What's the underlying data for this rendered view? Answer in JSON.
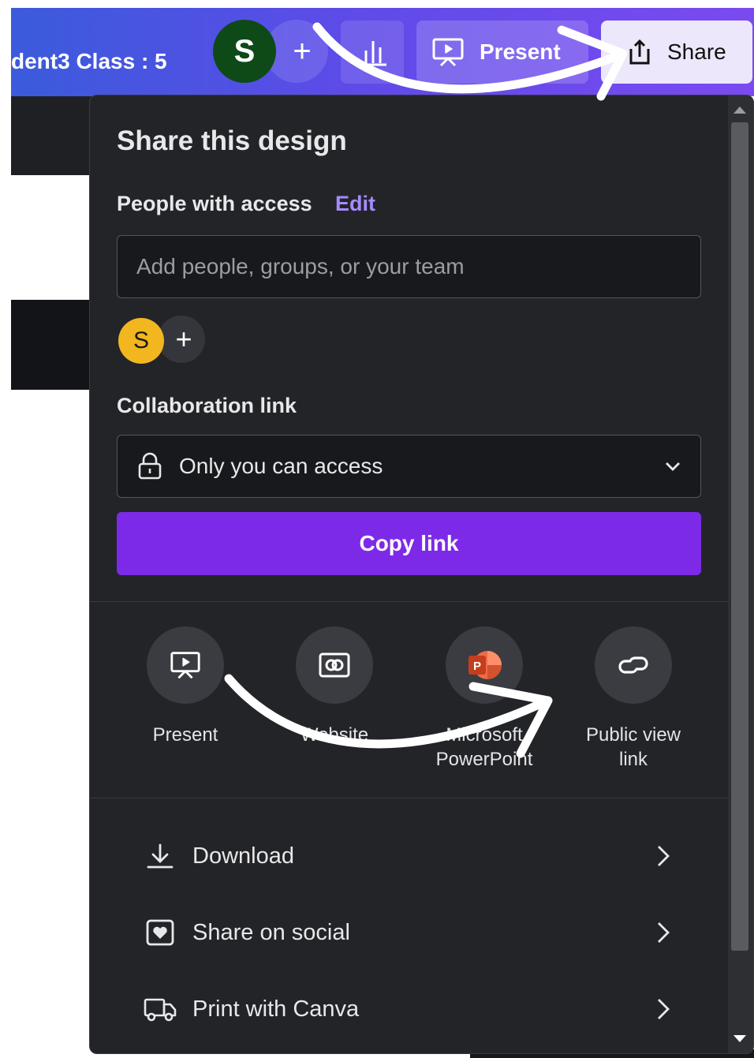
{
  "header": {
    "doc_title": "dent3 Class : 5",
    "avatar_initial": "S",
    "add_icon": "plus-icon",
    "insights_icon": "bar-chart-icon",
    "present_label": "Present",
    "share_label": "Share",
    "gradient_start": "#3b5bdb",
    "gradient_end": "#7a4af0",
    "avatar_color": "#0e4a17"
  },
  "share_panel": {
    "title": "Share this design",
    "people_access_label": "People with access",
    "edit_label": "Edit",
    "add_people_placeholder": "Add people, groups, or your team",
    "member_initial": "S",
    "member_color": "#f2b61f",
    "collaboration_label": "Collaboration link",
    "access_value": "Only you can access",
    "copy_link_label": "Copy link",
    "accent": "#7d2ae8",
    "share_options": [
      {
        "icon": "presentation-icon",
        "label": "Present"
      },
      {
        "icon": "website-icon",
        "label": "Website"
      },
      {
        "icon": "powerpoint-icon",
        "label": "Microsoft PowerPoint"
      },
      {
        "icon": "link-icon",
        "label": "Public view link"
      }
    ],
    "menu": [
      {
        "icon": "download-icon",
        "label": "Download"
      },
      {
        "icon": "heart-icon",
        "label": "Share on social"
      },
      {
        "icon": "truck-icon",
        "label": "Print with Canva"
      }
    ]
  }
}
